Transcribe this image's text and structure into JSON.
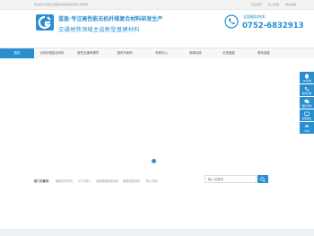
{
  "topbar": {
    "welcome": "欢迎您访问惠州蓝盈新材料科技有限公司官网",
    "links": [
      "设为首页",
      "加入收藏",
      "网站地图"
    ]
  },
  "header": {
    "title": "蓝盈·专注高性能无机纤维复合材料研发生产",
    "subtitle": "交通地铁领域主选新型基建材料",
    "hotline_label": "全国服务热线：",
    "hotline_number": "0752-6832913"
  },
  "nav": {
    "items": [
      "首页",
      "无机纤维复合材料",
      "新型交通声屏障",
      "国内外案例",
      "科研中心",
      "新闻动态",
      "走进蓝盈",
      "联系蓝盈"
    ]
  },
  "keywords": {
    "label": "热门关键词：",
    "items": [
      "隧道防护材料",
      "UCT材料",
      "高铁隧道防腐材料",
      "隧道防腐材料",
      "防火材料"
    ]
  },
  "search": {
    "placeholder": "输入关键词"
  },
  "sidebar": {
    "items": [
      {
        "label": "QQ咨询",
        "icon": "qq-icon"
      },
      {
        "label": "电话咨询",
        "icon": "phone-icon"
      },
      {
        "label": "微信咨询",
        "icon": "wechat-icon"
      },
      {
        "label": "在线留言",
        "icon": "message-icon"
      },
      {
        "label": "TOP",
        "icon": "arrow-up-icon"
      }
    ]
  },
  "colors": {
    "brand": "#2a8fd1"
  }
}
